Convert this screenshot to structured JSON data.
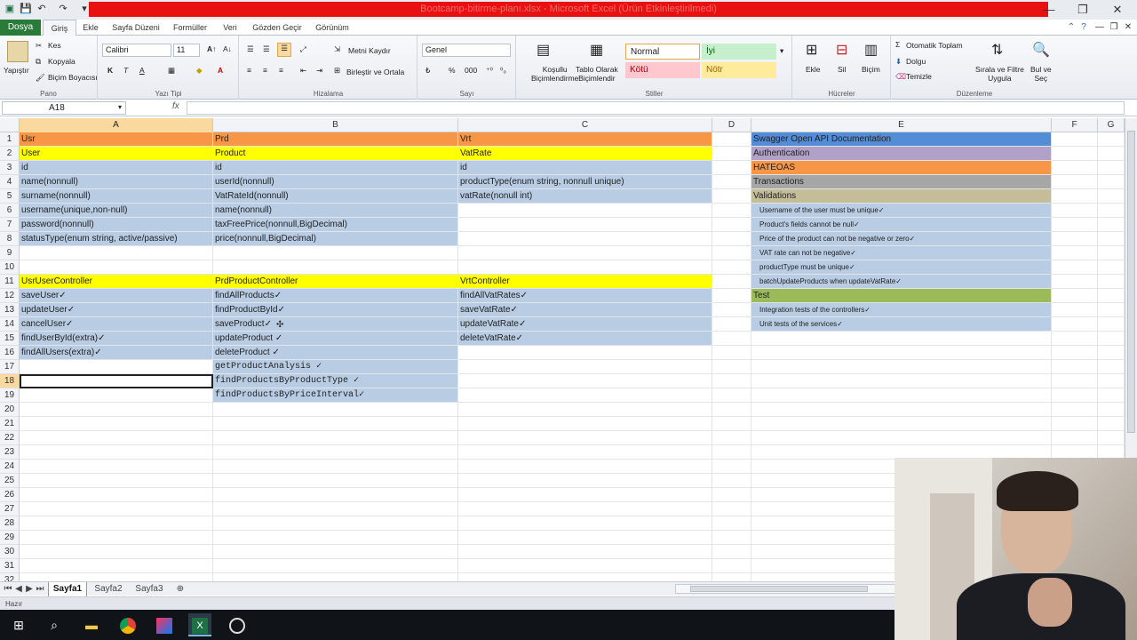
{
  "window": {
    "title": "Bootcamp-bitirme-planı.xlsx - Microsoft Excel (Ürün Etkinleştirilmedi)",
    "minimize": "—",
    "restore": "❐",
    "close": "✕"
  },
  "ribbon_tabs": {
    "file": "Dosya",
    "items": [
      "Giriş",
      "Ekle",
      "Sayfa Düzeni",
      "Formüller",
      "Veri",
      "Gözden Geçir",
      "Görünüm"
    ]
  },
  "ribbon": {
    "clipboard": {
      "paste": "Yapıştır",
      "cut": "Kes",
      "copy": "Kopyala",
      "format_painter": "Biçim Boyacısı",
      "label": "Pano"
    },
    "font": {
      "name": "Calibri",
      "size": "11",
      "label": "Yazı Tipi",
      "bold": "K",
      "italic": "T",
      "underline": "A"
    },
    "alignment": {
      "wrap": "Metni Kaydır",
      "merge": "Birleştir ve Ortala",
      "label": "Hizalama"
    },
    "number": {
      "format": "Genel",
      "label": "Sayı"
    },
    "styles": {
      "conditional": "Koşullu\nBiçimlendirme",
      "conditional_1": "Koşullu",
      "conditional_2": "Biçimlendirme",
      "table_1": "Tablo Olarak",
      "table_2": "Biçimlendir",
      "normal": "Normal",
      "good": "İyi",
      "bad": "Kötü",
      "neutral": "Nötr",
      "label": "Stiller"
    },
    "cells": {
      "insert": "Ekle",
      "delete": "Sil",
      "format": "Biçim",
      "label": "Hücreler"
    },
    "editing": {
      "autosum": "Otomatik Toplam",
      "fill": "Dolgu",
      "clear": "Temizle",
      "sort_1": "Sırala ve Filtre",
      "sort_2": "Uygula",
      "find_1": "Bul ve",
      "find_2": "Seç",
      "label": "Düzenleme"
    }
  },
  "formula_bar": {
    "name_box": "A18",
    "fx": "fx",
    "value": ""
  },
  "columns": [
    "A",
    "B",
    "C",
    "D",
    "E",
    "F",
    "G"
  ],
  "row_numbers": [
    "1",
    "2",
    "3",
    "4",
    "5",
    "6",
    "7",
    "8",
    "9",
    "10",
    "11",
    "12",
    "13",
    "14",
    "15",
    "16",
    "17",
    "18",
    "19",
    "20",
    "21",
    "22",
    "23",
    "24",
    "25",
    "26",
    "27",
    "28",
    "29",
    "30",
    "31",
    "32"
  ],
  "cells": {
    "A": [
      "Usr",
      "User",
      "id",
      "name(nonnull)",
      "surname(nonnull)",
      "username(unique,non-null)",
      "password(nonnull)",
      "statusType(enum string, active/passive)",
      "",
      "",
      "UsrUserController",
      "saveUser✓",
      "updateUser✓",
      "cancelUser✓",
      "findUserById(extra)✓",
      "findAllUsers(extra)✓",
      "",
      "",
      "",
      "",
      "",
      "",
      "",
      "",
      "",
      "",
      "",
      "",
      "",
      "",
      "",
      ""
    ],
    "B": [
      "Prd",
      "Product",
      "id",
      "userId(nonnull)",
      "VatRateId(nonnull)",
      "name(nonnull)",
      "taxFreePrice(nonnull,BigDecimal)",
      "price(nonnull,BigDecimal)",
      "",
      "",
      "PrdProductController",
      "findAllProducts✓",
      "findProductById✓",
      "saveProduct✓",
      "updateProduct ✓",
      "deleteProduct ✓",
      "getProductAnalysis ✓",
      "findProductsByProductType ✓",
      "findProductsByPriceInterval✓",
      "",
      "",
      "",
      "",
      "",
      "",
      "",
      "",
      "",
      "",
      "",
      "",
      ""
    ],
    "C": [
      "Vrt",
      "VatRate",
      "id",
      "productType(enum string, nonnull unique)",
      "vatRate(nonull int)",
      "",
      "",
      "",
      "",
      "",
      "VrtController",
      "findAllVatRates✓",
      "saveVatRate✓",
      "updateVatRate✓",
      "deleteVatRate✓",
      "",
      "",
      "",
      "",
      "",
      "",
      "",
      "",
      "",
      "",
      "",
      "",
      "",
      "",
      "",
      "",
      ""
    ],
    "E": [
      "Swagger Open API Documentation",
      "Authentication",
      "HATEOAS",
      "Transactions",
      "Validations",
      "Username of the user must be unique✓",
      "Product's fields cannot be null✓",
      "Price of the product can not be negative or zero✓",
      "VAT rate can not be negative✓",
      "productType must be unique✓",
      "batchUpdateProducts when updateVatRate✓",
      "Test",
      "Integration tests of the controllers✓",
      "Unit tests of the services✓",
      "",
      "",
      "",
      "",
      "",
      "",
      "",
      "",
      "",
      "",
      "",
      "",
      "",
      "",
      "",
      "",
      "",
      ""
    ]
  },
  "sheet_tabs": [
    "Sayfa1",
    "Sayfa2",
    "Sayfa3"
  ],
  "status": "Hazır",
  "colors": {
    "excel_green": "#2a7a3a",
    "orange": "#f79646",
    "yellow": "#ffff00",
    "light_blue": "#b8cce4",
    "dark_blue": "#538dd5",
    "purple": "#b1a0c7",
    "gray": "#a6a6a6",
    "tan": "#c4bd97",
    "green": "#9bbb59"
  },
  "taskbar_icons": [
    "windows-icon",
    "search-icon",
    "file-explorer-icon",
    "chrome-icon",
    "intellij-icon",
    "excel-icon",
    "obs-icon"
  ]
}
